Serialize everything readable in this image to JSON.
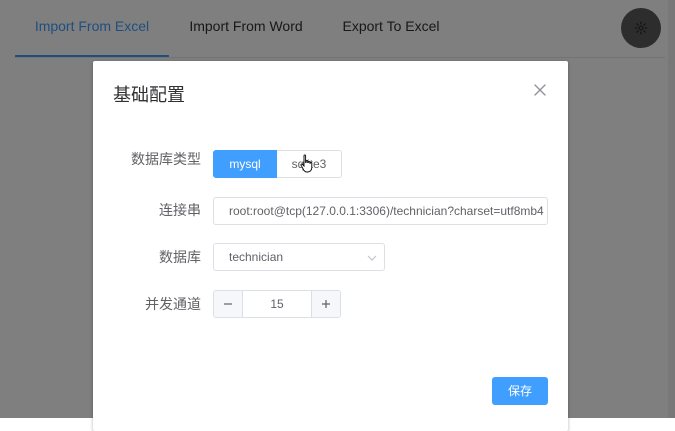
{
  "tabs": [
    {
      "label": "Import From Excel",
      "active": true
    },
    {
      "label": "Import From Word",
      "active": false
    },
    {
      "label": "Export To Excel",
      "active": false
    }
  ],
  "settings_icon": "gear-icon",
  "accent_color": "#409eff",
  "dialog": {
    "title": "基础配置",
    "close_icon": "close-icon",
    "fields": {
      "db_type": {
        "label": "数据库类型",
        "options": [
          "mysql",
          "sqlite3"
        ],
        "selected": "mysql"
      },
      "connection": {
        "label": "连接串",
        "value": "root:root@tcp(127.0.0.1:3306)/technician?charset=utf8mb4"
      },
      "database": {
        "label": "数据库",
        "value": "technician",
        "arrow_icon": "chevron-down-icon"
      },
      "concurrency": {
        "label": "并发通道",
        "value": "15",
        "minus_icon": "minus-icon",
        "plus_icon": "plus-icon"
      }
    },
    "save_label": "保存"
  }
}
